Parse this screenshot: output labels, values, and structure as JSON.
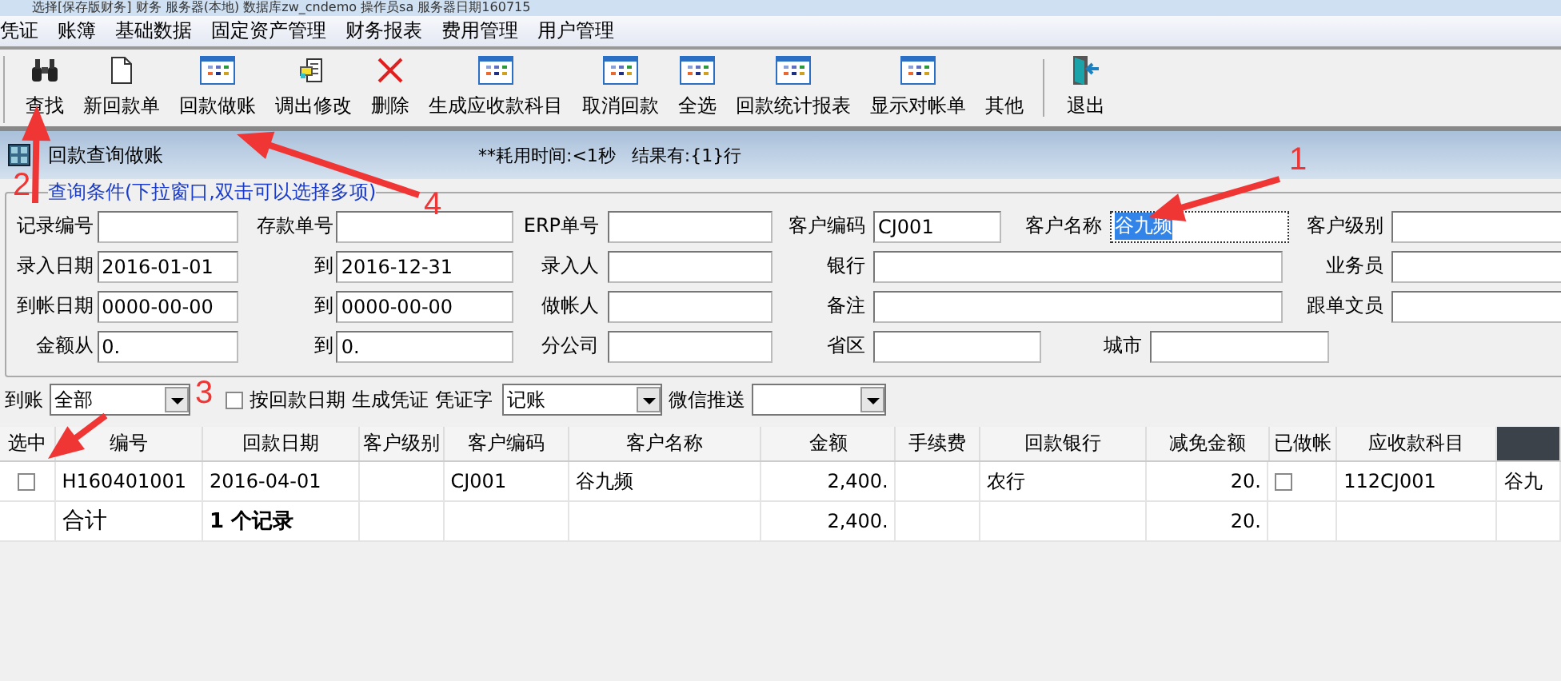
{
  "window": {
    "title": "选择[保存版财务] 财务 服务器(本地) 数据库zw_cndemo 操作员sa 服务器日期160715"
  },
  "menu": [
    {
      "label": "凭证"
    },
    {
      "label": "账簿"
    },
    {
      "label": "基础数据"
    },
    {
      "label": "固定资产管理"
    },
    {
      "label": "财务报表"
    },
    {
      "label": "费用管理"
    },
    {
      "label": "用户管理"
    }
  ],
  "toolbar": [
    {
      "label": "查找"
    },
    {
      "label": "新回款单"
    },
    {
      "label": "回款做账"
    },
    {
      "label": "调出修改"
    },
    {
      "label": "删除"
    },
    {
      "label": "生成应收款科目"
    },
    {
      "label": "取消回款"
    },
    {
      "label": "全选"
    },
    {
      "label": "回款统计报表"
    },
    {
      "label": "显示对帐单"
    },
    {
      "label": "其他"
    },
    {
      "label": "退出"
    }
  ],
  "panel": {
    "title": "回款查询做账",
    "timing": "**耗用时间:<1秒",
    "result": "结果有:{1}行"
  },
  "query": {
    "legend": "查询条件(下拉窗口,双击可以选择多项)",
    "rows": [
      {
        "left": [
          {
            "label": "记录编号"
          },
          {
            "label": "存款单号"
          },
          {
            "label": "ERP单号"
          }
        ],
        "right": [
          {
            "label": "客户编码",
            "value": "CJ001",
            "kind": "short"
          },
          {
            "label": "客户名称",
            "value": "谷九频",
            "kind": "normal",
            "selected": true
          },
          {
            "label": "客户级别",
            "kind": "normal"
          }
        ]
      },
      {
        "left": [
          {
            "label": "录入日期",
            "value": "2016-01-01"
          },
          {
            "label": "到",
            "value": "2016-12-31"
          },
          {
            "label": "录入人"
          }
        ],
        "right": [
          {
            "label": "银行",
            "kind": "wide"
          },
          {
            "label": "业务员",
            "kind": "normal"
          }
        ]
      },
      {
        "left": [
          {
            "label": "到帐日期",
            "value": "0000-00-00"
          },
          {
            "label": "到",
            "value": "0000-00-00"
          },
          {
            "label": "做帐人"
          }
        ],
        "right": [
          {
            "label": "备注",
            "kind": "wide"
          },
          {
            "label": "跟单文员",
            "kind": "normal"
          }
        ]
      },
      {
        "left": [
          {
            "label": "金额从",
            "value": "0."
          },
          {
            "label": "到",
            "value": "0."
          },
          {
            "label": "分公司"
          }
        ],
        "right": [
          {
            "label": "省区",
            "kind": "medium"
          },
          {
            "label": "城市",
            "kind": "normal"
          }
        ]
      }
    ]
  },
  "filters": [
    {
      "kind": "combo",
      "label": "到账",
      "value": "全部"
    },
    {
      "kind": "checkbox",
      "label": "按回款日期 生成凭证",
      "checked": false
    },
    {
      "kind": "combo",
      "label": "凭证字",
      "value": "记账"
    },
    {
      "kind": "combo",
      "label": "微信推送"
    }
  ],
  "table": {
    "columns": [
      {
        "label": "选中",
        "kind": "check"
      },
      {
        "label": "编号",
        "kind": "text"
      },
      {
        "label": "回款日期",
        "kind": "text"
      },
      {
        "label": "客户级别",
        "kind": "text"
      },
      {
        "label": "客户编码",
        "kind": "text"
      },
      {
        "label": "客户名称",
        "kind": "text"
      },
      {
        "label": "金额",
        "kind": "number"
      },
      {
        "label": "手续费",
        "kind": "number"
      },
      {
        "label": "回款银行",
        "kind": "text"
      },
      {
        "label": "减免金额",
        "kind": "number"
      },
      {
        "label": "已做帐",
        "kind": "check"
      },
      {
        "label": "应收款科目",
        "kind": "text"
      },
      {
        "kind": "blank"
      }
    ],
    "rows": [
      {
        "kind": "data",
        "cells": [
          {
            "checked": false
          },
          "H160401001",
          "2016-04-01",
          null,
          "CJ001",
          "谷九频",
          "2,400.",
          null,
          "农行",
          "20.",
          {
            "checked": false
          },
          "112CJ001",
          "谷九"
        ]
      },
      {
        "kind": "total",
        "cells": [
          null,
          "合计",
          "1 个记录",
          null,
          null,
          null,
          "2,400.",
          null,
          null,
          "20.",
          null,
          null,
          null
        ]
      }
    ]
  },
  "annotations": [
    {
      "label": "1"
    },
    {
      "label": "2"
    },
    {
      "label": "3"
    },
    {
      "label": "4"
    }
  ]
}
